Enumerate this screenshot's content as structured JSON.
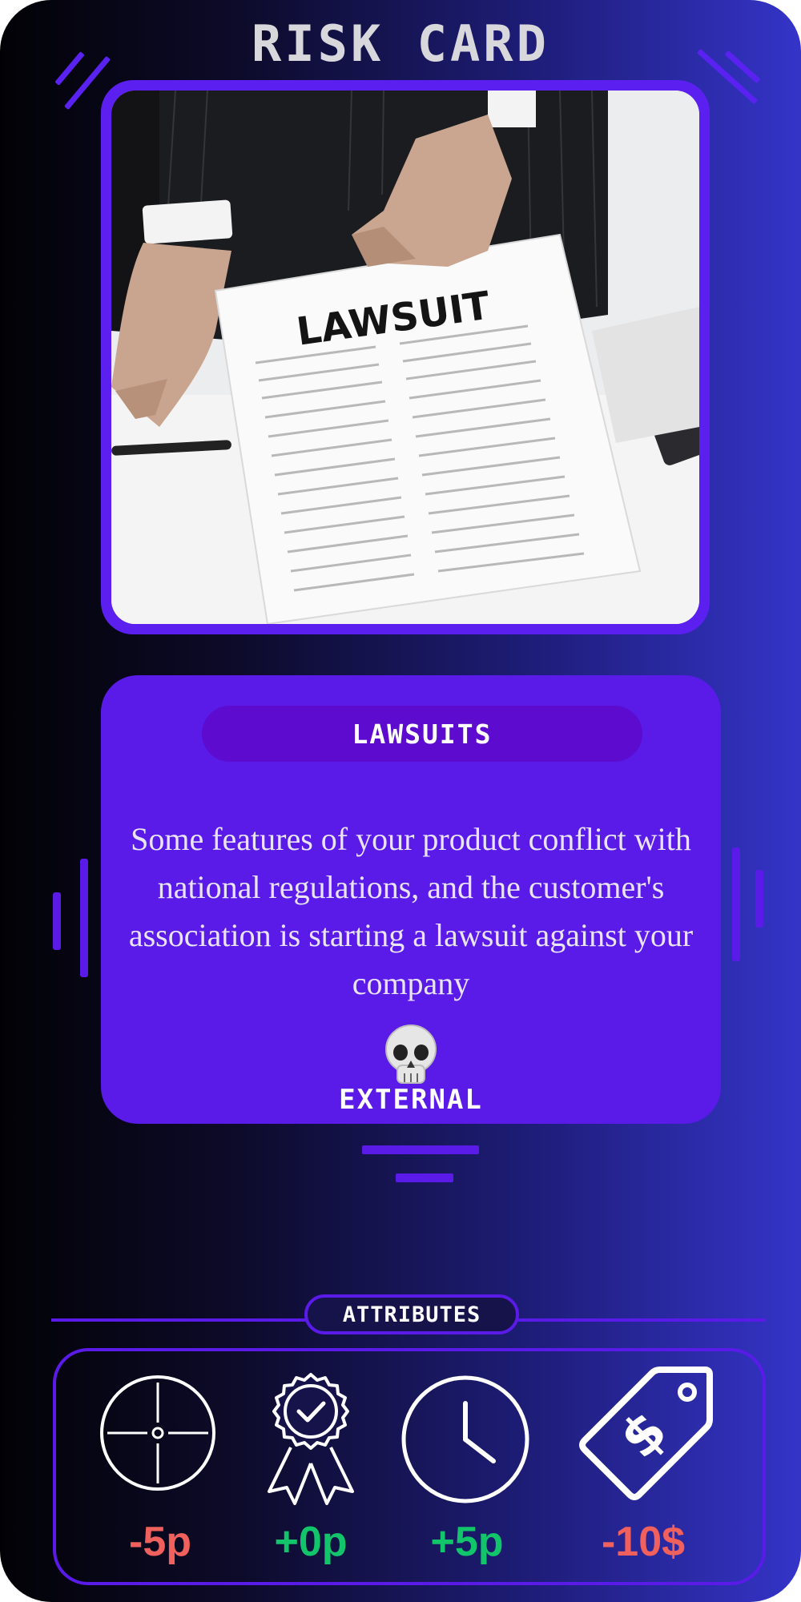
{
  "card": {
    "title": "RISK CARD",
    "image_caption_word": "LAWSUIT",
    "risk_name": "LAWSUITS",
    "description": "Some features of your product conflict with national regulations, and the customer's association is starting a lawsuit against your company",
    "type_icon": "skull-icon",
    "type_label": "EXTERNAL"
  },
  "attributes": {
    "header": "ATTRIBUTES",
    "items": [
      {
        "icon": "crosshair-icon",
        "value": "-5p",
        "color": "#f0605c"
      },
      {
        "icon": "award-badge-icon",
        "value": "+0p",
        "color": "#12c56a"
      },
      {
        "icon": "clock-icon",
        "value": "+5p",
        "color": "#12c56a"
      },
      {
        "icon": "price-tag-icon",
        "value": "-10$",
        "color": "#f0605c"
      }
    ]
  },
  "colors": {
    "accent": "#5a1ae8",
    "negative": "#f0605c",
    "positive": "#12c56a",
    "title_text": "#d8d8dc"
  }
}
